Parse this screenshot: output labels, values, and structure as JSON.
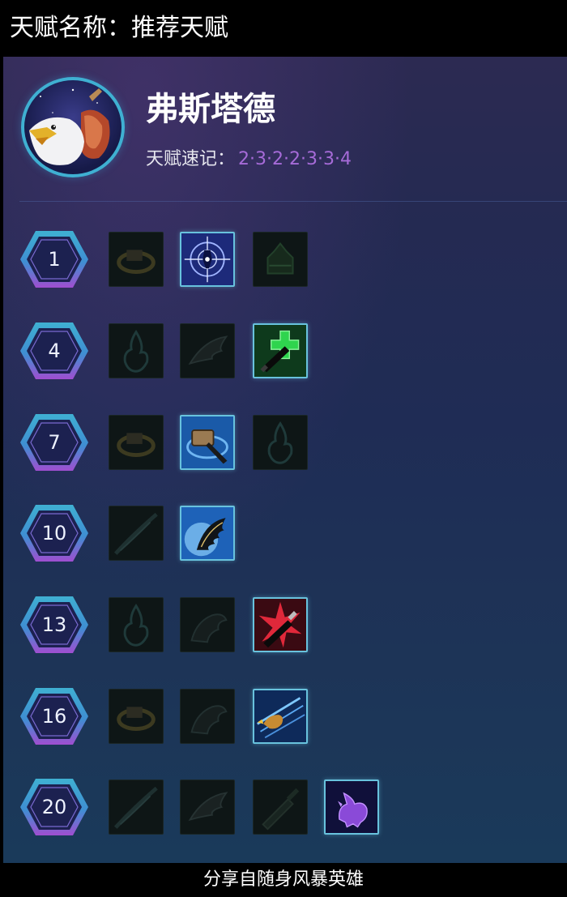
{
  "header": {
    "title": "天赋名称：推荐天赋"
  },
  "hero": {
    "name": "弗斯塔德"
  },
  "quick": {
    "label": "天赋速记：",
    "value": "2·3·2·2·3·3·4"
  },
  "tiers": [
    {
      "level": "1"
    },
    {
      "level": "4"
    },
    {
      "level": "7"
    },
    {
      "level": "10"
    },
    {
      "level": "13"
    },
    {
      "level": "16"
    },
    {
      "level": "20"
    }
  ],
  "footer": {
    "text": "分享自随身风暴英雄"
  },
  "colors": {
    "accent_purple": "#a66bd8",
    "selected_border": "#68c2dd",
    "badge_cyan": "#3fb0d2",
    "badge_purple": "#a04ed0"
  }
}
